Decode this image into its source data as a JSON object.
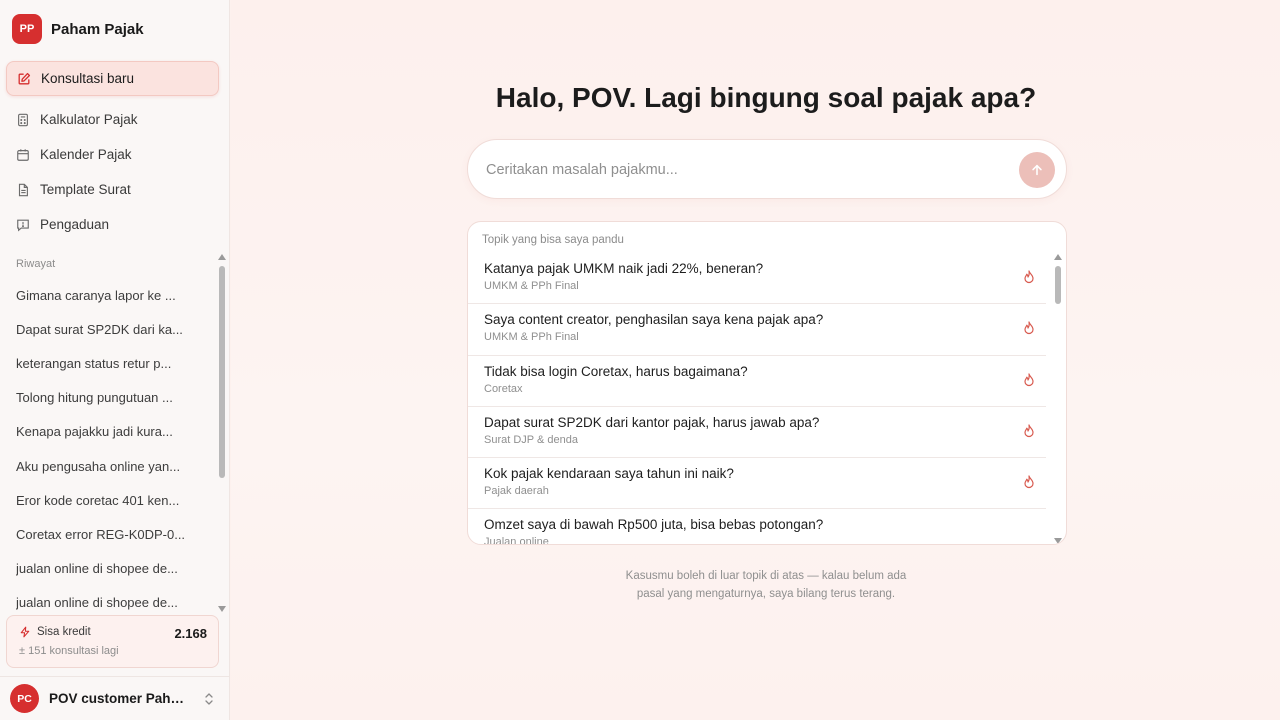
{
  "brand": {
    "logo_text": "PP",
    "name": "Paham Pajak",
    "accent": "#d62f2f"
  },
  "nav": {
    "new_chat": {
      "label": "Konsultasi baru",
      "icon": "edit-icon"
    },
    "items": [
      {
        "label": "Kalkulator Pajak",
        "icon": "calculator-icon"
      },
      {
        "label": "Kalender Pajak",
        "icon": "calendar-icon"
      },
      {
        "label": "Template Surat",
        "icon": "document-icon"
      },
      {
        "label": "Pengaduan",
        "icon": "message-alert-icon"
      }
    ]
  },
  "history": {
    "label": "Riwayat",
    "items": [
      "Gimana caranya lapor ke ...",
      "Dapat surat SP2DK dari ka...",
      "keterangan status retur p...",
      "Tolong hitung pungutuan ...",
      "Kenapa pajakku jadi kura...",
      "Aku pengusaha online yan...",
      "Eror kode coretac 401 ken...",
      "Coretax error REG-K0DP-0...",
      "jualan online di shopee de...",
      "jualan online di shopee de..."
    ]
  },
  "credit": {
    "label": "Sisa kredit",
    "value": "2.168",
    "sub": "± 151 konsultasi lagi"
  },
  "user": {
    "initials": "PC",
    "name": "POV customer Paham Pajak"
  },
  "main": {
    "title": "Halo, POV. Lagi bingung soal pajak apa?",
    "chat_placeholder": "Ceritakan masalah pajakmu...",
    "topics_label": "Topik yang bisa saya pandu",
    "topics": [
      {
        "q": "Katanya pajak UMKM naik jadi 22%, beneran?",
        "cat": "UMKM & PPh Final"
      },
      {
        "q": "Saya content creator, penghasilan saya kena pajak apa?",
        "cat": "UMKM & PPh Final"
      },
      {
        "q": "Tidak bisa login Coretax, harus bagaimana?",
        "cat": "Coretax"
      },
      {
        "q": "Dapat surat SP2DK dari kantor pajak, harus jawab apa?",
        "cat": "Surat DJP & denda"
      },
      {
        "q": "Kok pajak kendaraan saya tahun ini naik?",
        "cat": "Pajak daerah"
      },
      {
        "q": "Omzet saya di bawah Rp500 juta, bisa bebas potongan?",
        "cat": "Jualan online"
      }
    ],
    "note_line1": "Kasusmu boleh di luar topik di atas — kalau belum ada",
    "note_line2": "pasal yang mengaturnya, saya bilang terus terang."
  }
}
